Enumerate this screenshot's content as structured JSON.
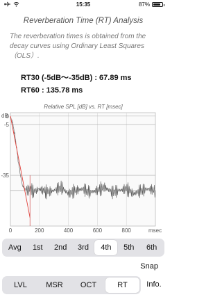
{
  "status": {
    "time": "15:35",
    "battery": "87%",
    "battery_level": 0.87
  },
  "title": "Reverberation Time (RT) Analysis",
  "description": "The reverberation times is obtained from the decay curves using Ordinary Least Squares（OLS）.",
  "results": {
    "rt30": "RT30 (-5dB～-35dB) : 67.89 ms",
    "rt60": "RT60 : 135.78 ms"
  },
  "chart_data": {
    "type": "line",
    "title": "Relative SPL [dB] vs. RT [msec]",
    "ylabel": "dB",
    "xlabel": "msec",
    "xlim": [
      0,
      1000
    ],
    "ylim": [
      -65,
      2
    ],
    "y_ticks": [
      "0",
      "-5",
      "-35"
    ],
    "y_tick_values": [
      0,
      -5,
      -35
    ],
    "x_ticks": [
      "0",
      "200",
      "400",
      "600",
      "800"
    ],
    "x_tick_values": [
      0,
      200,
      400,
      600,
      800
    ],
    "noise_floor_db": -44,
    "series": [
      {
        "x": [
          0,
          10,
          20,
          30,
          40,
          50,
          60,
          70,
          80,
          90,
          100,
          120,
          140,
          160,
          180,
          200,
          250,
          300,
          350,
          400,
          450,
          500,
          550,
          600,
          650,
          700,
          750,
          800,
          850,
          900,
          950,
          1000
        ],
        "y": [
          -1,
          -2,
          -6,
          -11,
          -17,
          -24,
          -30,
          -35,
          -40,
          -42,
          -43,
          -44,
          -43,
          -45,
          -44,
          -43,
          -45,
          -44,
          -42,
          -46,
          -44,
          -43,
          -45,
          -44,
          -42,
          -45,
          -44,
          -43,
          -46,
          -44,
          -43,
          -44
        ]
      },
      {
        "x": [
          0,
          135
        ],
        "y": [
          0,
          -60
        ]
      }
    ],
    "colors": {
      "decay": "#555555",
      "regression": "#e0403a",
      "marker": "#d04a48",
      "grid": "#cfcfcf"
    }
  },
  "octave_tabs": [
    {
      "label": "Avg"
    },
    {
      "label": "1st"
    },
    {
      "label": "2nd"
    },
    {
      "label": "3rd"
    },
    {
      "label": "4th"
    },
    {
      "label": "5th"
    },
    {
      "label": "6th"
    }
  ],
  "octave_selected": 4,
  "snap_label": "Snap",
  "mode_tabs": [
    {
      "label": "LVL"
    },
    {
      "label": "MSR"
    },
    {
      "label": "OCT"
    },
    {
      "label": "RT"
    }
  ],
  "mode_selected": 3,
  "info_label": "Info."
}
